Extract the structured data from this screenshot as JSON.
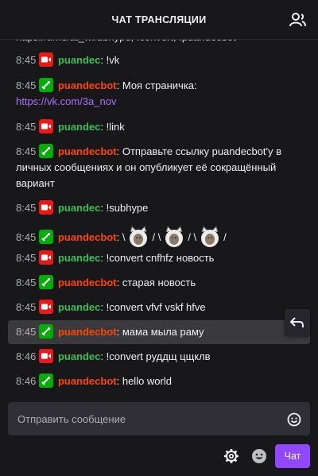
{
  "header": {
    "title": "ЧАТ ТРАНСЛЯЦИИ",
    "users_icon": "users-icon"
  },
  "partial_line": "https://t.me/at_wi/ubhype, !convert, !puandecbot",
  "messages": [
    {
      "time": "8:45",
      "badge": "streamer",
      "user": "puandec",
      "text": "!vk"
    },
    {
      "time": "8:45",
      "badge": "moderator",
      "user": "puandecbot",
      "text": "Моя страничка:",
      "link": "https://vk.com/3a_nov"
    },
    {
      "time": "8:45",
      "badge": "streamer",
      "user": "puandec",
      "text": "!link"
    },
    {
      "time": "8:45",
      "badge": "moderator",
      "user": "puandecbot",
      "text_line1": "Отправьте ссылку puandecbot'у в",
      "text_line2": "личных сообщениях и он опубликует её сокращённый",
      "text_line3": "вариант"
    },
    {
      "time": "8:45",
      "badge": "streamer",
      "user": "puandec",
      "text": "!subhype"
    },
    {
      "time": "8:45",
      "badge": "moderator",
      "user": "puandecbot",
      "sep1": "\\",
      "sep2": "/ \\",
      "sep3": "/ \\",
      "sep4": "/",
      "emote": "cat-emote"
    },
    {
      "time": "8:45",
      "badge": "streamer",
      "user": "puandec",
      "text": "!convert cnfhfz новость"
    },
    {
      "time": "8:45",
      "badge": "moderator",
      "user": "puandecbot",
      "text": "старая новость"
    },
    {
      "time": "8:45",
      "badge": "streamer",
      "user": "puandec",
      "text": "!convert vfvf vskf hfve"
    },
    {
      "time": "8:45",
      "badge": "moderator",
      "user": "puandecbot",
      "text": "мама мыла раму",
      "highlighted": true
    },
    {
      "time": "8:46",
      "badge": "streamer",
      "user": "puandec",
      "text": "!convert руддщ цщклв"
    },
    {
      "time": "8:46",
      "badge": "moderator",
      "user": "puandecbot",
      "text": "hello world"
    }
  ],
  "input": {
    "placeholder": "Отправить сообщение"
  },
  "footer": {
    "chat_button": "Чат"
  },
  "colors": {
    "streamer_badge": "#e91916",
    "mod_badge": "#00ad03",
    "puandec": "#3dbd58",
    "puandecbot": "#ff4500",
    "accent": "#9147ff",
    "link": "#a970ff"
  }
}
